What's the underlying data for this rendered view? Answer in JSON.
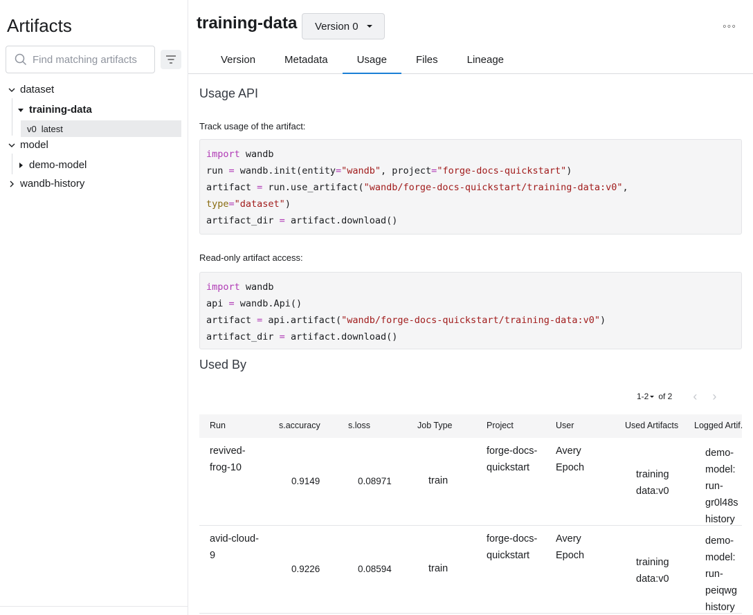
{
  "sidebar": {
    "title": "Artifacts",
    "search_placeholder": "Find matching artifacts",
    "tree": {
      "dataset": "dataset",
      "training_data": "training-data",
      "version": "v0",
      "alias": "latest",
      "model": "model",
      "demo_model": "demo-model",
      "wandb_history": "wandb-history"
    }
  },
  "header": {
    "artifact_name": "training-data",
    "version_dropdown": "Version 0",
    "more": "◦◦◦",
    "tabs": [
      "Version",
      "Metadata",
      "Usage",
      "Files",
      "Lineage"
    ],
    "active_tab": "Usage"
  },
  "usage": {
    "title": "Usage API",
    "track_caption": "Track usage of the artifact:",
    "readonly_caption": "Read-only artifact access:",
    "track_code": [
      "import wandb",
      "run = wandb.init(entity=\"wandb\", project=\"forge-docs-quickstart\")",
      "artifact = run.use_artifact(\"wandb/forge-docs-quickstart/training-data:v0\",",
      "type=\"dataset\")",
      "artifact_dir = artifact.download()"
    ],
    "readonly_code": [
      "import wandb",
      "api = wandb.Api()",
      "artifact = api.artifact(\"wandb/forge-docs-quickstart/training-data:v0\")",
      "artifact_dir = artifact.download()"
    ]
  },
  "used_by": {
    "title": "Used By",
    "pager": {
      "range": "1-2",
      "of": "of 2"
    },
    "columns": [
      "Run",
      "s.accuracy",
      "s.loss",
      "Job Type",
      "Project",
      "User",
      "Used Artifacts",
      "Logged Artif."
    ],
    "rows": [
      {
        "run": [
          "revived-",
          "frog-10"
        ],
        "accuracy": "0.9149",
        "loss": "0.08971",
        "job_type": "train",
        "project": [
          "forge-docs-",
          "quickstart"
        ],
        "user": [
          "Avery",
          "Epoch"
        ],
        "used": [
          "training",
          "data:v0"
        ],
        "logged": [
          "demo-",
          "model:",
          "run-",
          "gr0l48s",
          "history"
        ]
      },
      {
        "run": [
          "avid-cloud-",
          "9"
        ],
        "accuracy": "0.9226",
        "loss": "0.08594",
        "job_type": "train",
        "project": [
          "forge-docs-",
          "quickstart"
        ],
        "user": [
          "Avery",
          "Epoch"
        ],
        "used": [
          "training",
          "data:v0"
        ],
        "logged": [
          "demo-",
          "model:",
          "run-",
          "peiqwg",
          "history"
        ]
      }
    ]
  }
}
